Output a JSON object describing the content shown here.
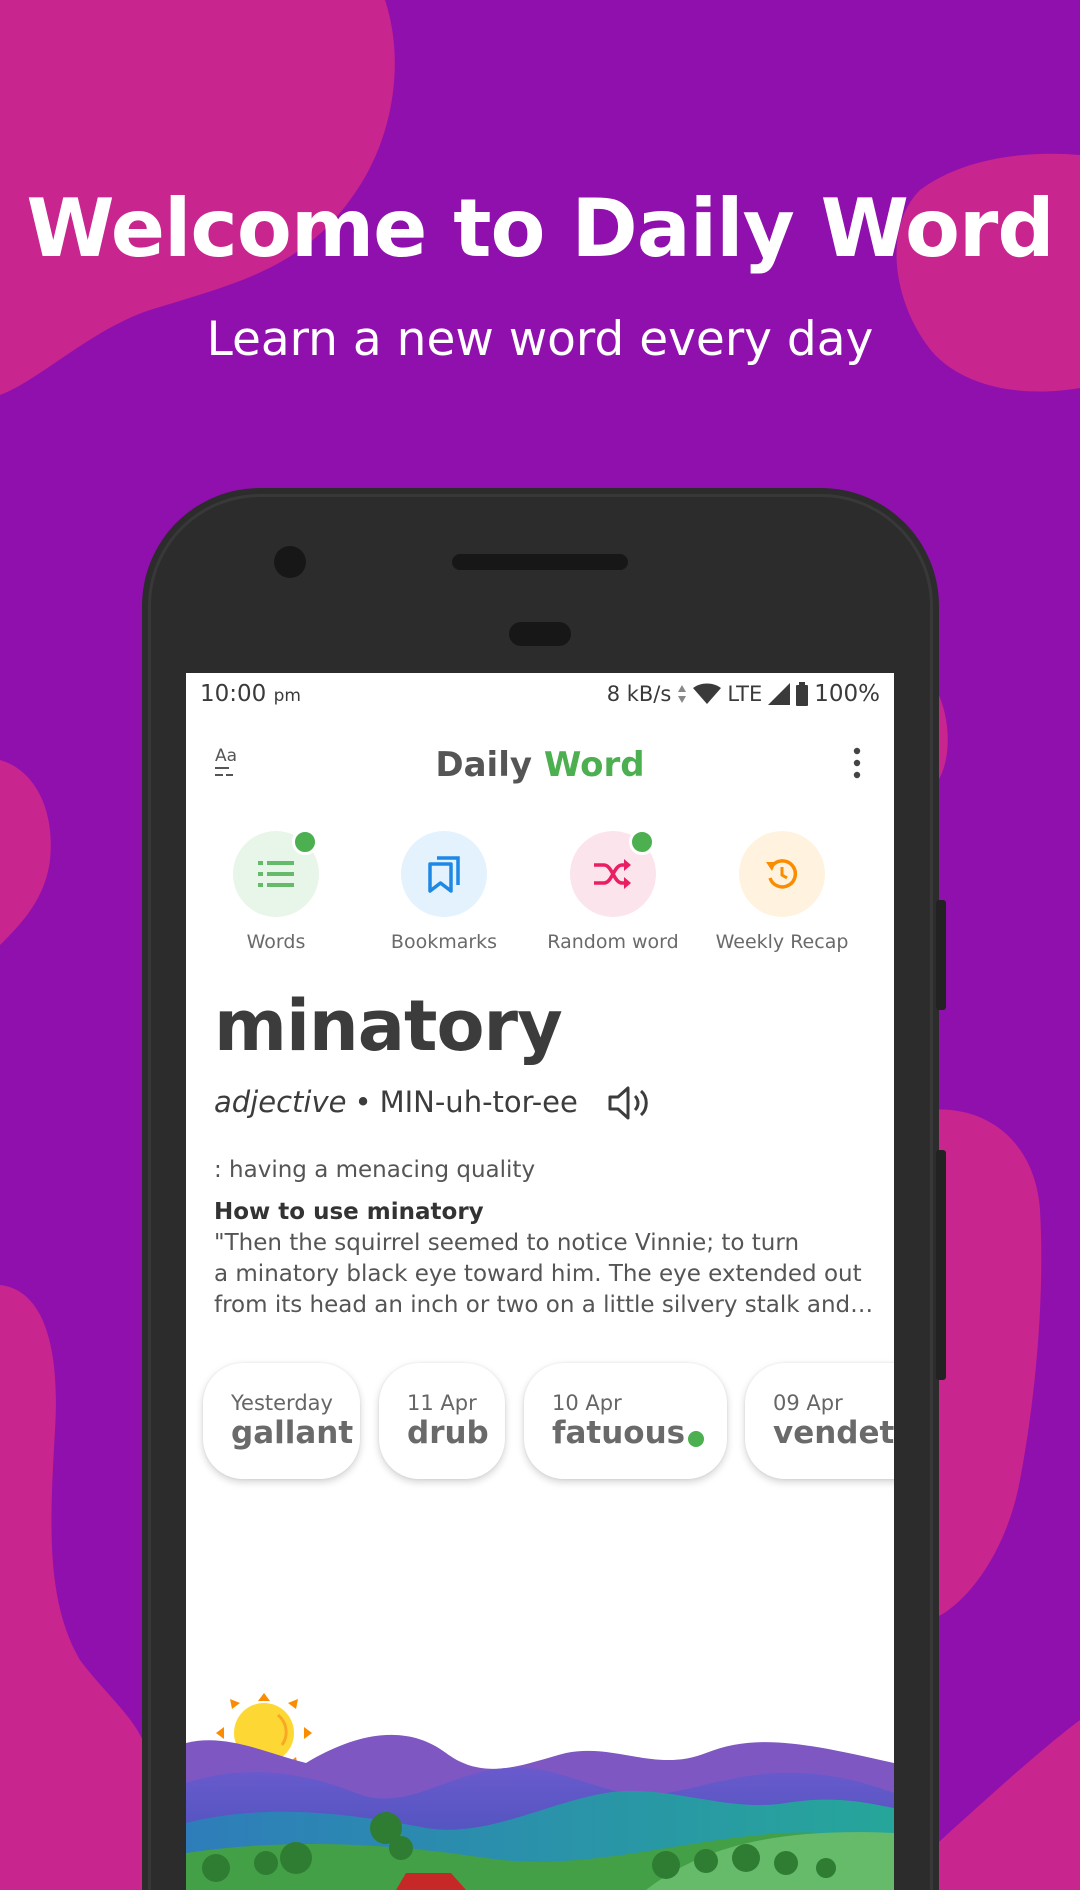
{
  "hero": {
    "title": "Welcome to Daily Word",
    "subtitle": "Learn a new word every day"
  },
  "colors": {
    "background": "#8f10ad",
    "blobs": "#c8258f",
    "accent_green": "#4caf50",
    "words_icon": "#66bb6a",
    "bookmarks_icon": "#1e88e5",
    "random_icon": "#e91e63",
    "recap_icon": "#fb8c00"
  },
  "status_bar": {
    "time": "10:00",
    "ampm": "pm",
    "speed": "8 kB/s",
    "network": "LTE",
    "battery": "100%"
  },
  "app_bar": {
    "title_part1": "Daily",
    "title_part2": "Word",
    "left_icon": "text-size-icon",
    "right_icon": "overflow-menu-icon"
  },
  "shortcuts": [
    {
      "label": "Words",
      "icon": "list-icon",
      "has_dot": true
    },
    {
      "label": "Bookmarks",
      "icon": "bookmarks-icon",
      "has_dot": false
    },
    {
      "label": "Random word",
      "icon": "shuffle-icon",
      "has_dot": true
    },
    {
      "label": "Weekly Recap",
      "icon": "history-icon",
      "has_dot": false
    }
  ],
  "word_card": {
    "word": "minatory",
    "part_of_speech": "adjective",
    "separator": "•",
    "pronunciation": "MIN-uh-tor-ee",
    "definition": ": having a menacing quality",
    "usage_title": "How to use minatory",
    "usage_lines": [
      "\"Then the squirrel seemed to notice Vinnie; to turn",
      "a minatory black eye toward him. The eye extended out",
      "from its head an inch or two on a little silvery stalk and ti…"
    ]
  },
  "history": [
    {
      "date": "Yesterday",
      "word": "gallant",
      "unread": false
    },
    {
      "date": "11 Apr",
      "word": "drub",
      "unread": false
    },
    {
      "date": "10 Apr",
      "word": "fatuous",
      "unread": true
    },
    {
      "date": "09 Apr",
      "word": "vendetta",
      "unread": false
    }
  ]
}
